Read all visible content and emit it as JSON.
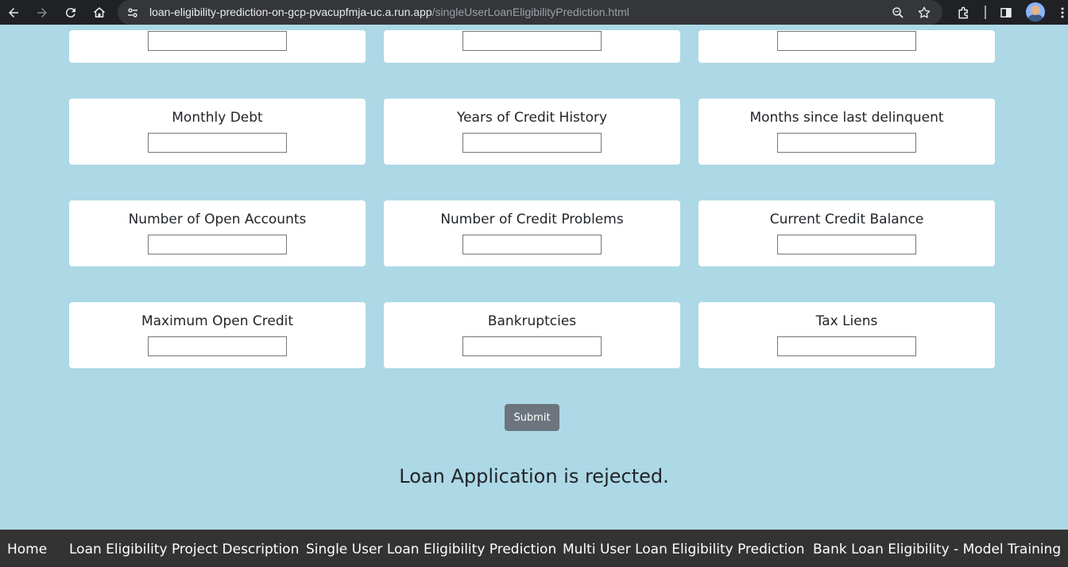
{
  "browser": {
    "url_host": "loan-eligibility-prediction-on-gcp-pvacupfmja-uc.a.run.app",
    "url_path": "/singleUserLoanEligibilityPrediction.html",
    "icons": [
      "back-icon",
      "forward-icon",
      "reload-icon",
      "home-icon",
      "site-info-icon",
      "zoom-icon",
      "bookmark-star-icon",
      "extensions-icon",
      "side-panel-icon",
      "profile-avatar",
      "menu-kebab-icon"
    ]
  },
  "form": {
    "top_fields": [
      "",
      "",
      ""
    ],
    "fields": [
      {
        "label": "Monthly Debt",
        "value": ""
      },
      {
        "label": "Years of Credit History",
        "value": ""
      },
      {
        "label": "Months since last delinquent",
        "value": ""
      },
      {
        "label": "Number of Open Accounts",
        "value": ""
      },
      {
        "label": "Number of Credit Problems",
        "value": ""
      },
      {
        "label": "Current Credit Balance",
        "value": ""
      },
      {
        "label": "Maximum Open Credit",
        "value": ""
      },
      {
        "label": "Bankruptcies",
        "value": ""
      },
      {
        "label": "Tax Liens",
        "value": ""
      }
    ],
    "submit_label": "Submit"
  },
  "result": {
    "message": "Loan Application is rejected."
  },
  "footer": {
    "links": [
      "Home",
      "Loan Eligibility Project Description",
      "Single User Loan Eligibility Prediction",
      "Multi User Loan Eligibility Prediction",
      "Bank Loan Eligibility - Model Training"
    ]
  },
  "colors": {
    "page_background": "#add8e6",
    "card_background": "#ffffff",
    "submit_background": "#6c757d",
    "footer_background": "#333333"
  }
}
